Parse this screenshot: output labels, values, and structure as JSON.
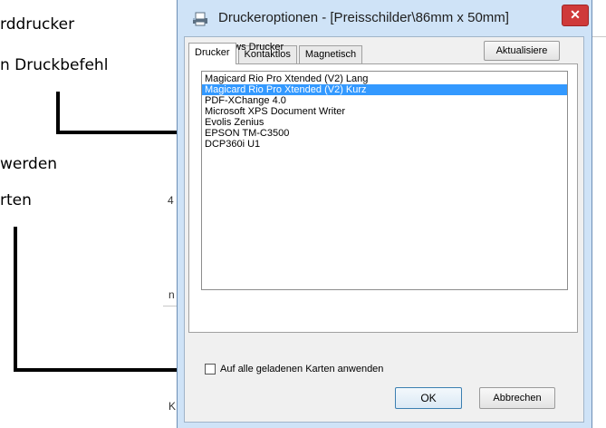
{
  "annotations": {
    "line1": "rddrucker",
    "line2": "n Druckbefehl",
    "line3": "werden",
    "line4": "rten"
  },
  "background_fragments": {
    "f1": "4",
    "f2": "n",
    "f3": "K"
  },
  "dialog": {
    "title": "Druckeroptionen - [Preisschilder\\86mm x 50mm]",
    "close_glyph": "✕",
    "tabs": [
      {
        "label": "Drucker",
        "active": true
      },
      {
        "label": "Kontaktlos",
        "active": false
      },
      {
        "label": "Magnetisch",
        "active": false
      }
    ],
    "radio_label": "Windows Drucker",
    "refresh_label": "Aktualisiere",
    "printers": [
      "Magicard Rio Pro Xtended (V2) Lang",
      "Magicard Rio Pro Xtended (V2) Kurz",
      "PDF-XChange 4.0",
      "Microsoft XPS Document Writer",
      "Evolis Zenius",
      "EPSON TM-C3500",
      "DCP360i U1"
    ],
    "selected_printer_index": 1,
    "apply_all_label": "Auf alle geladenen Karten anwenden",
    "apply_all_checked": false,
    "ok_label": "OK",
    "cancel_label": "Abbrechen"
  },
  "colors": {
    "selection": "#3399ff",
    "close_button": "#cf3a3a",
    "window_frame": "#cfe3f7"
  }
}
